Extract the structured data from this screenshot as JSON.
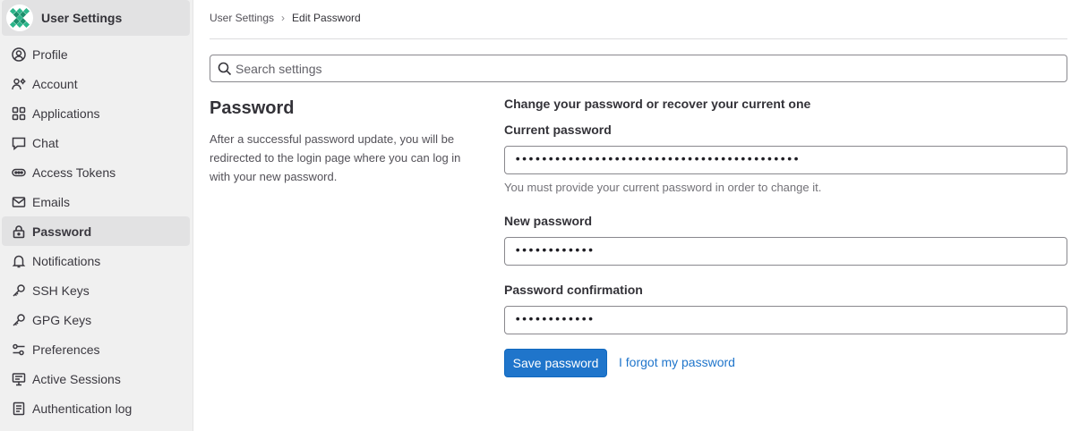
{
  "sidebar": {
    "title": "User Settings",
    "items": [
      {
        "label": "Profile",
        "icon": "profile-icon"
      },
      {
        "label": "Account",
        "icon": "account-icon"
      },
      {
        "label": "Applications",
        "icon": "applications-icon"
      },
      {
        "label": "Chat",
        "icon": "chat-icon"
      },
      {
        "label": "Access Tokens",
        "icon": "token-icon"
      },
      {
        "label": "Emails",
        "icon": "mail-icon"
      },
      {
        "label": "Password",
        "icon": "lock-icon",
        "active": true
      },
      {
        "label": "Notifications",
        "icon": "bell-icon"
      },
      {
        "label": "SSH Keys",
        "icon": "key-icon"
      },
      {
        "label": "GPG Keys",
        "icon": "key-icon"
      },
      {
        "label": "Preferences",
        "icon": "preferences-icon"
      },
      {
        "label": "Active Sessions",
        "icon": "monitor-icon"
      },
      {
        "label": "Authentication log",
        "icon": "log-icon"
      }
    ]
  },
  "breadcrumb": {
    "parent": "User Settings",
    "separator": "›",
    "current": "Edit Password"
  },
  "search": {
    "placeholder": "Search settings",
    "value": ""
  },
  "section": {
    "title": "Password",
    "description": "After a successful password update, you will be redirected to the login page where you can log in with your new password."
  },
  "form": {
    "intro": "Change your password or recover your current one",
    "current_label": "Current password",
    "current_value": "•••••••••••••••••••••••••••••••••••••••••••",
    "current_help": "You must provide your current password in order to change it.",
    "new_label": "New password",
    "new_value": "••••••••••••",
    "confirm_label": "Password confirmation",
    "confirm_value": "••••••••••••",
    "save_label": "Save password",
    "forgot_label": "I forgot my password"
  },
  "colors": {
    "accent": "#1f75cb",
    "sidebar_bg": "#f0f0f0",
    "active_bg": "#e2e2e3"
  }
}
